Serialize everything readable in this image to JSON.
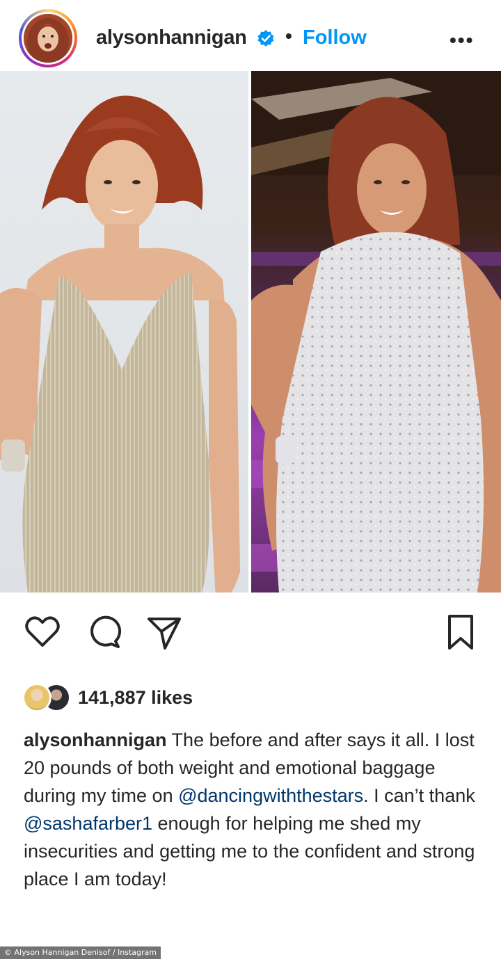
{
  "post": {
    "username": "alysonhannigan",
    "verified_icon": "verified-badge-icon",
    "separator": "•",
    "follow_label": "Follow",
    "more_label": "•••"
  },
  "actions": {
    "like_icon": "heart-icon",
    "comment_icon": "comment-icon",
    "share_icon": "send-icon",
    "save_icon": "bookmark-icon"
  },
  "likes": {
    "count_text": "141,887 likes"
  },
  "caption": {
    "username": "alysonhannigan",
    "text_1": " The before and after says it all. I lost 20 pounds of both weight and emotional baggage during my time on ",
    "mention_1": "@dancingwiththestars",
    "text_2": ". I can’t thank ",
    "mention_2": "@sashafarber1",
    "text_3": " enough for helping me shed my insecurities and getting me to the confident and strong place I am today!"
  },
  "credit": "© Alyson Hannigan Denisof / Instagram",
  "colors": {
    "accent_blue": "#0095f6",
    "mention_blue": "#00376b",
    "text": "#262626"
  }
}
